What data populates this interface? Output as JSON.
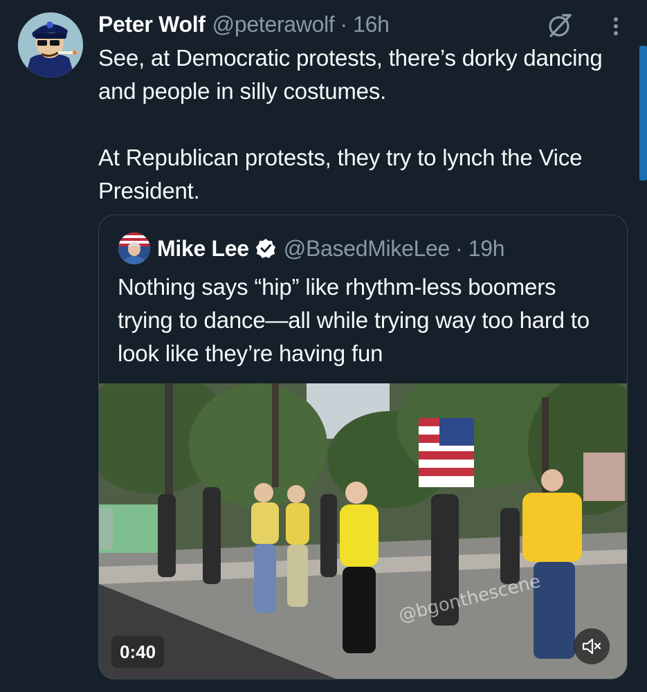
{
  "tweet": {
    "author_name": "Peter Wolf",
    "author_handle": "@peterawolf",
    "separator": "·",
    "time": "16h",
    "text_paragraph_1": "See, at Democratic protests, there’s dorky dancing and people in silly costumes.",
    "text_paragraph_2": "At Republican protests, they try to lynch the Vice President."
  },
  "quoted": {
    "author_name": "Mike Lee",
    "author_handle": "@BasedMikeLee",
    "separator": "·",
    "time": "19h",
    "text": "Nothing says “hip” like rhythm-less boomers trying to dance—all while trying way too hard to look like they’re having fun",
    "video": {
      "duration": "0:40",
      "watermark": "@bgonthescene",
      "muted": true
    }
  },
  "icons": {
    "grok": "grok-icon",
    "more": "more-vertical-icon",
    "verified": "verified-badge-icon",
    "mute": "speaker-muted-icon"
  },
  "colors": {
    "background": "#15202b",
    "secondary_text": "#8b98a5",
    "border": "#38444d",
    "accent": "#1d9bf0"
  }
}
